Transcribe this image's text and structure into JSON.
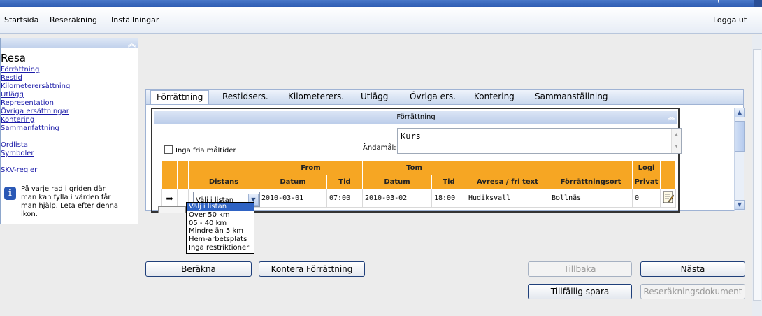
{
  "window": {
    "caption_fragment": "("
  },
  "menu": {
    "items": [
      "Startsida",
      "Reseräkning",
      "Inställningar"
    ],
    "logout": "Logga ut"
  },
  "sidebar": {
    "title": "Resa",
    "links": [
      "Förrättning",
      "Restid",
      "Kilometerersättning",
      "Utlägg",
      "Representation",
      "Övriga ersättningar",
      "Kontering",
      "Sammanfattning"
    ],
    "links2": [
      "Ordlista",
      "Symboler"
    ],
    "links3": [
      "SKV-regler"
    ],
    "info": [
      "På varje rad i griden där",
      "man kan fylla i värden får",
      "man hjälp. Leta efter denna",
      "ikon."
    ]
  },
  "tabs": [
    "Förrättning",
    "Restidsers.",
    "Kilometerers.",
    "Utlägg",
    "Övriga ers.",
    "Kontering",
    "Sammanställning"
  ],
  "panel": {
    "title": "Förrättning",
    "no_free_meals_label": "Inga fria måltider",
    "purpose_label": "Ändamål:",
    "purpose_value": "Kurs"
  },
  "grid": {
    "group_headers": {
      "from": "From",
      "to": "Tom",
      "lodging": "Logi"
    },
    "columns": {
      "distance": "Distans",
      "from_date": "Datum",
      "from_time": "Tid",
      "to_date": "Datum",
      "to_time": "Tid",
      "destination": "Avresa / fri text",
      "place": "Förrättningsort",
      "private": "Privat"
    },
    "row": {
      "distance": "Välj i listan",
      "from_date": "2010-03-01",
      "from_time": "07:00",
      "to_date": "2010-03-02",
      "to_time": "18:00",
      "destination": "Hudiksvall",
      "place": "Bollnäs",
      "private": "0"
    }
  },
  "dropdown": {
    "options": [
      "Välj i listan",
      "Över 50 km",
      "05 - 40 km",
      "Mindre än 5 km",
      "Hem-arbetsplats",
      "Inga restriktioner"
    ],
    "selected": 0
  },
  "buttons": {
    "calculate": "Beräkna",
    "post": "Kontera Förrättning",
    "back": "Tillbaka",
    "next": "Nästa",
    "save": "Tillfällig spara",
    "document": "Reseräkningsdokument"
  }
}
